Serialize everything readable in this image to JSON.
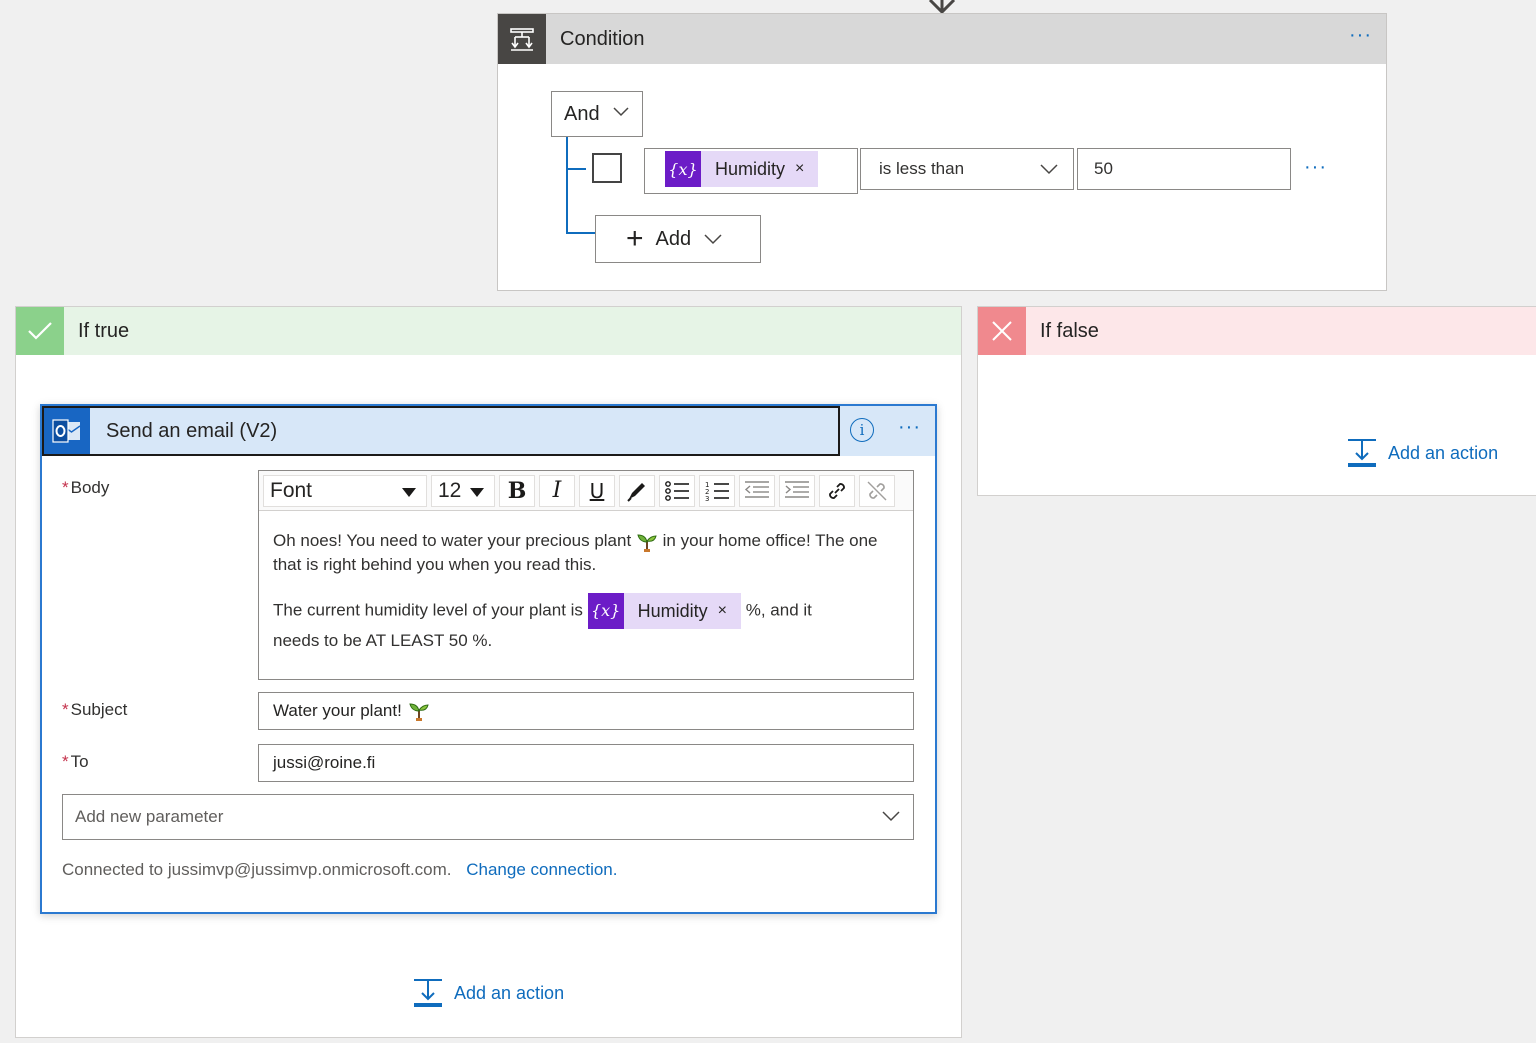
{
  "condition": {
    "title": "Condition",
    "group_operator": "And",
    "row": {
      "token_label": "Humidity",
      "token_remove": "×",
      "token_glyph": "{x}",
      "operator": "is less than",
      "value": "50"
    },
    "add_label": "Add",
    "more_glyph": "···"
  },
  "if_true": {
    "title": "If true",
    "add_action_label": "Add an action"
  },
  "if_false": {
    "title": "If false",
    "add_action_label": "Add an action"
  },
  "email": {
    "title": "Send an email (V2)",
    "info_glyph": "i",
    "more_glyph": "···",
    "required_mark": "*",
    "body_label": "Body",
    "toolbar": {
      "font": "Font",
      "size": "12",
      "bold": "B",
      "italic": "I",
      "underline": "U"
    },
    "body_para1": "Oh noes! You need to water your precious plant",
    "body_para1b": "in your home office! The one that is right behind you when you read this.",
    "body_para2a": "The current humidity level of your plant is",
    "body_token_label": "Humidity",
    "body_token_remove": "×",
    "body_token_glyph": "{x}",
    "body_para2b": "%, and it",
    "body_para2c": "needs to be AT LEAST 50 %.",
    "subject_label": "Subject",
    "subject_value": "Water your plant!",
    "to_label": "To",
    "to_value": "jussi@roine.fi",
    "add_param_placeholder": "Add new parameter",
    "connection_text": "Connected to jussimvp@jussimvp.onmicrosoft.com.",
    "change_connection": "Change connection."
  },
  "colors": {
    "accent": "#0f6cbd",
    "token": "#6c1cc7",
    "true_green": "#8bd18b",
    "false_red": "#f0898e"
  }
}
